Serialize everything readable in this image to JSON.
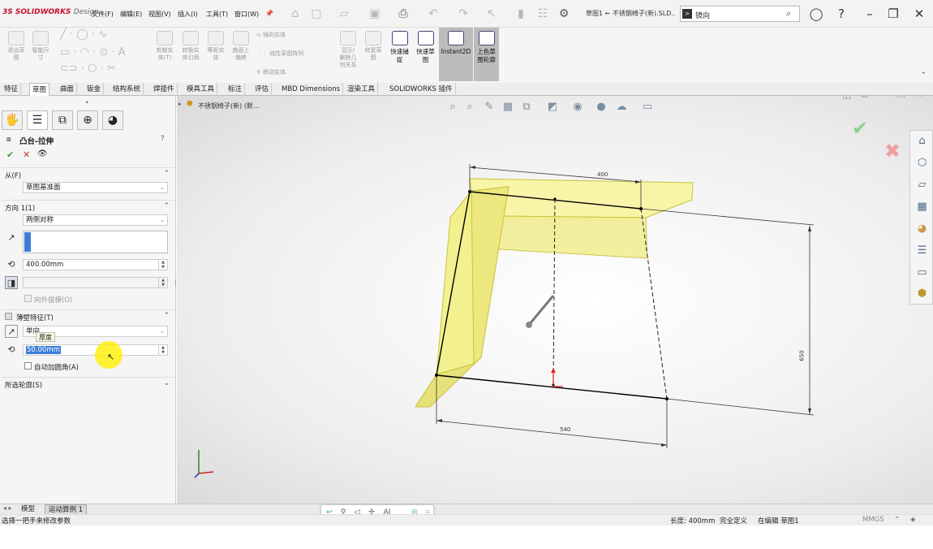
{
  "app": {
    "brand": "SOLIDWORKS",
    "brand_suffix": "Design",
    "menus": [
      "文件(F)",
      "编辑(E)",
      "视图(V)",
      "插入(I)",
      "工具(T)",
      "窗口(W)"
    ],
    "pin_icon": "pin-icon",
    "document_title": "草图1 ← 不锈钢椅子(新).SLD...",
    "search": {
      "placeholder": "",
      "value": "镜向"
    },
    "accent": "#c8102e"
  },
  "ribbon": {
    "disabled_items": [
      {
        "label": "退出草\n图"
      },
      {
        "label": "智能尺\n寸"
      },
      {
        "label": "剪裁实\n体(T)"
      },
      {
        "label": "转换实\n体引用"
      },
      {
        "label": "等距实\n体"
      },
      {
        "label": "曲面上\n偏移"
      },
      {
        "label": "镜向实体"
      },
      {
        "label": "线性草图阵列"
      },
      {
        "label": "移动实体"
      },
      {
        "label": "显示/\n删除几\n何关系"
      },
      {
        "label": "修复草\n图"
      }
    ],
    "buttons": [
      {
        "label": "快速捕\n捉"
      },
      {
        "label": "快速草\n图"
      },
      {
        "label": "Instant2D",
        "active": true
      },
      {
        "label": "上色草\n图轮廓",
        "active": true
      }
    ]
  },
  "tabs": [
    "特征",
    "草图",
    "曲面",
    "钣金",
    "结构系统",
    "焊接件",
    "模具工具",
    "标注",
    "评估",
    "MBD Dimensions",
    "渲染工具",
    "SOLIDWORKS 插件"
  ],
  "active_tab": "草图",
  "feature_tree_crumb": "不锈钢椅子(新) (默...",
  "property_manager": {
    "title": "凸台-拉伸",
    "from": {
      "header": "从(F)",
      "value": "草图基准面"
    },
    "direction1": {
      "header": "方向 1(1)",
      "end_condition": "两侧对称",
      "depth": "400.00mm",
      "draft_outward": "向外拔模(O)"
    },
    "thin_feature": {
      "header": "薄壁特征(T)",
      "type": "单向",
      "tooltip": "厚度",
      "thickness": "50.00mm",
      "auto_fillet": "自动加圆角(A)"
    },
    "selected_contours": {
      "header": "所选轮廓(S)"
    }
  },
  "sketch": {
    "dimensions": {
      "top": "400",
      "bottom": "540",
      "height": "650"
    }
  },
  "bottom_tabs": [
    "模型",
    "运动算例 1"
  ],
  "status": {
    "hint": "选择一把手来修改参数",
    "length": "长度: 400mm",
    "state": "完全定义",
    "editing": "在编辑 草图1",
    "units": "MMGS"
  },
  "hud_ai": "AI",
  "colors": {
    "extrude_fill": "#f3f08a",
    "extrude_edge": "#c9c23a",
    "ok_check": "#5fb85f",
    "cancel_x": "#e06060",
    "selection": "#3b7dd8"
  }
}
